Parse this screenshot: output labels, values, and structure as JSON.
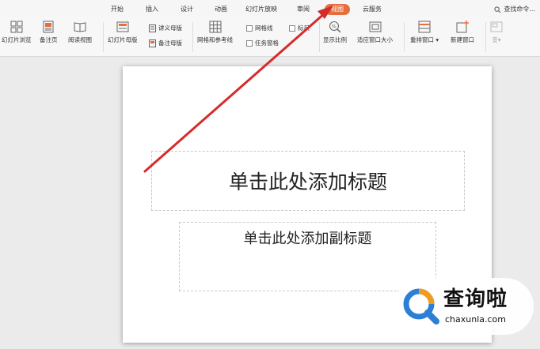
{
  "tabs": [
    "开始",
    "插入",
    "设计",
    "动画",
    "幻灯片放映",
    "审阅",
    "视图",
    "云服务"
  ],
  "active_tab": "视图",
  "search_label": "查找命令...",
  "ribbon": {
    "slide_browse": "幻灯片浏览",
    "notes_page": "备注页",
    "reading_view": "阅读视图",
    "slide_master": "幻灯片母版",
    "handout_master": "讲义母版",
    "notes_master": "备注母版",
    "grid_guides": "网格和参考线",
    "gridlines": "网格线",
    "ruler": "标尺",
    "task_pane": "任务窗格",
    "zoom": "显示比例",
    "fit_window": "适应窗口大小",
    "arrange_window": "重排窗口",
    "new_window": "新建窗口",
    "cut_partial": "变"
  },
  "slide": {
    "title_placeholder": "单击此处添加标题",
    "subtitle_placeholder": "单击此处添加副标题"
  },
  "watermark": {
    "brand": "查询啦",
    "url": "chaxunla.com"
  },
  "colors": {
    "accent_tab": "#e46f3e",
    "arrow": "#d62b2b",
    "logo_blue": "#2d7fd6",
    "logo_orange": "#f29a1f"
  }
}
